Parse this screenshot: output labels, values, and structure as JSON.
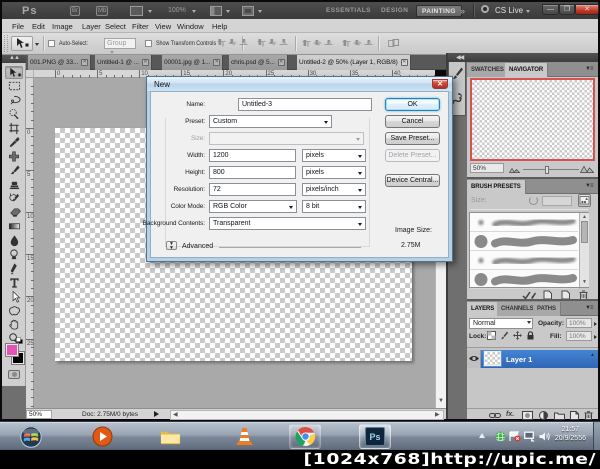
{
  "app_bar": {
    "logo": "Ps",
    "bridge_icon": "Br",
    "mini_bridge_icon": "Mb",
    "zoom_level": "100%",
    "workspaces": [
      "ESSENTIALS",
      "DESIGN",
      "PAINTING"
    ],
    "active_workspace": "PAINTING",
    "overflow": "»",
    "cs_live_label": "CS Live"
  },
  "menu_bar": {
    "items": [
      "File",
      "Edit",
      "Image",
      "Layer",
      "Select",
      "Filter",
      "View",
      "Window",
      "Help"
    ]
  },
  "options_bar": {
    "auto_select_label": "Auto-Select:",
    "auto_select_value": "Group",
    "show_transform_label": "Show Transform Controls"
  },
  "document_tabs": [
    {
      "label": "001.PNG @ 33..."
    },
    {
      "label": "Untitled-1 @ ..."
    },
    {
      "label": "00001.jpg @ 1..."
    },
    {
      "label": "chris.psd @ 5..."
    },
    {
      "label": "Untitled-2 @ 50% (Layer 1, RGB/8)"
    }
  ],
  "toolbar": {
    "tools": [
      "move",
      "marquee",
      "lasso",
      "quick-select",
      "crop",
      "eyedropper",
      "healing",
      "brush",
      "clone-stamp",
      "history-brush",
      "eraser",
      "gradient",
      "blur",
      "dodge",
      "pen",
      "type",
      "path-select",
      "shape",
      "hand",
      "zoom"
    ],
    "selected_tool": "move",
    "foreground_color": "#e553b4",
    "background_color": "#000000"
  },
  "ruler": {
    "h_labels": [
      "0",
      "5",
      "10",
      "15",
      "20",
      "25",
      "30",
      "35",
      "40"
    ],
    "v_labels": [
      "0",
      "5",
      "10",
      "15",
      "20",
      "25"
    ]
  },
  "dialog": {
    "title": "New",
    "name_label": "Name:",
    "name_value": "Untitled-3",
    "preset_label": "Preset:",
    "preset_value": "Custom",
    "size_label": "Size:",
    "width_label": "Width:",
    "width_value": "1200",
    "width_unit": "pixels",
    "height_label": "Height:",
    "height_value": "800",
    "height_unit": "pixels",
    "resolution_label": "Resolution:",
    "resolution_value": "72",
    "resolution_unit": "pixels/inch",
    "color_mode_label": "Color Mode:",
    "color_mode_value": "RGB Color",
    "bit_depth_value": "8 bit",
    "background_label": "Background Contents:",
    "background_value": "Transparent",
    "image_size_label": "Image Size:",
    "image_size_value": "2.75M",
    "advanced_label": "Advanced",
    "ok": "OK",
    "cancel": "Cancel",
    "save_preset": "Save Preset...",
    "delete_preset": "Delete Preset...",
    "device_central": "Device Central..."
  },
  "panels": {
    "navigator": {
      "tabs": [
        "SWATCHES",
        "NAVIGATOR"
      ],
      "active_tab": "NAVIGATOR",
      "zoom_value": "50%"
    },
    "brush_presets": {
      "title": "BRUSH PRESETS",
      "size_label": "Size:",
      "rows": [
        "soft-small",
        "hard-large",
        "soft-small",
        "hard-large"
      ]
    },
    "layers": {
      "tabs": [
        "LAYERS",
        "CHANNELS",
        "PATHS"
      ],
      "active_tab": "LAYERS",
      "blend_mode": "Normal",
      "opacity_label": "Opacity:",
      "opacity_value": "100%",
      "lock_label": "Lock:",
      "fill_label": "Fill:",
      "fill_value": "100%",
      "layer_name": "Layer 1"
    }
  },
  "status_bar": {
    "zoom": "50%",
    "doc_info": "Doc: 2.75M/0 bytes"
  },
  "taskbar": {
    "clock_time": "21:57",
    "clock_date": "20/9/2556",
    "ps_button_label": "Ps"
  },
  "watermark": "[1024x768]http://upic.me/"
}
